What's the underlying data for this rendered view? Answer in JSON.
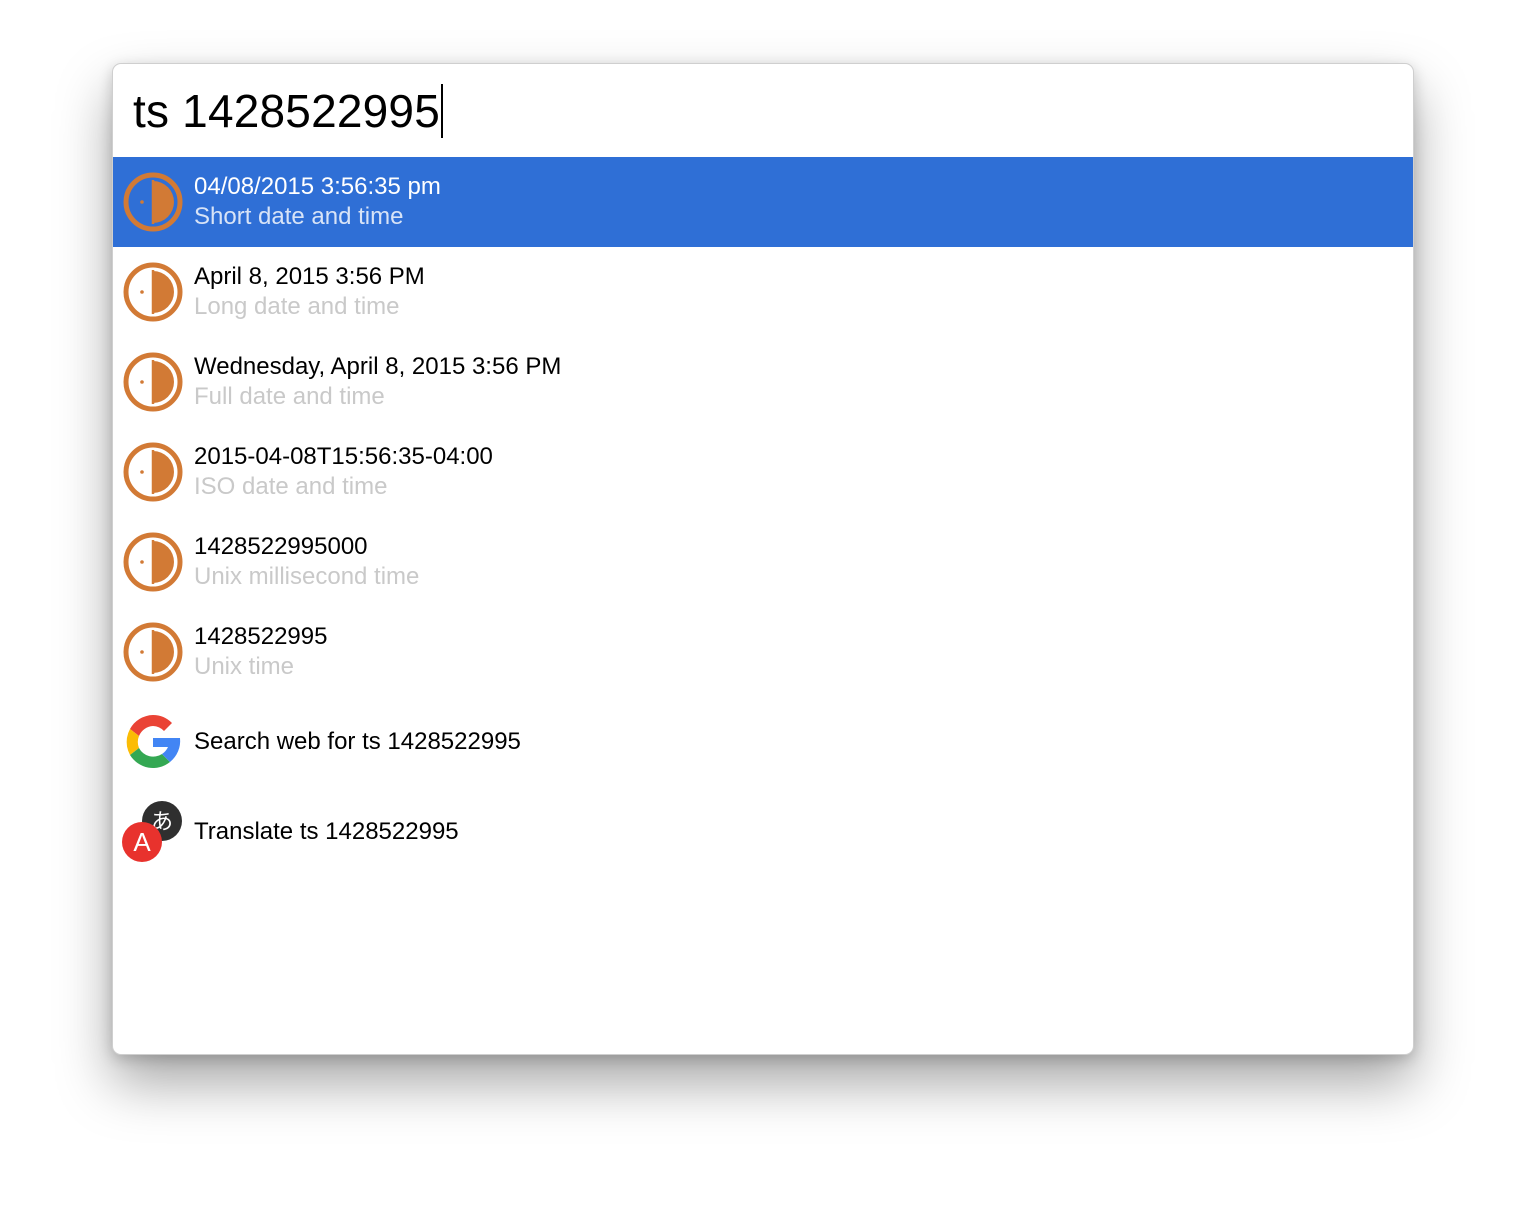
{
  "search": {
    "query": "ts 1428522995"
  },
  "colors": {
    "selection": "#2f6fd6",
    "clock_orange": "#d27a35",
    "subtitle_gray": "#c9c9c9"
  },
  "results": [
    {
      "title": "04/08/2015 3:56:35 pm",
      "subtitle": "Short date and time",
      "icon": "timestamp-icon",
      "selected": true
    },
    {
      "title": "April 8, 2015 3:56 PM",
      "subtitle": "Long date and time",
      "icon": "timestamp-icon"
    },
    {
      "title": "Wednesday, April 8, 2015 3:56 PM",
      "subtitle": "Full date and time",
      "icon": "timestamp-icon"
    },
    {
      "title": "2015-04-08T15:56:35-04:00",
      "subtitle": "ISO date and time",
      "icon": "timestamp-icon"
    },
    {
      "title": "1428522995000",
      "subtitle": "Unix millisecond time",
      "icon": "timestamp-icon"
    },
    {
      "title": "1428522995",
      "subtitle": "Unix time",
      "icon": "timestamp-icon"
    },
    {
      "title": "Search web for ts 1428522995",
      "icon": "google-icon"
    },
    {
      "title": "Translate ts 1428522995",
      "icon": "translate-icon"
    }
  ]
}
